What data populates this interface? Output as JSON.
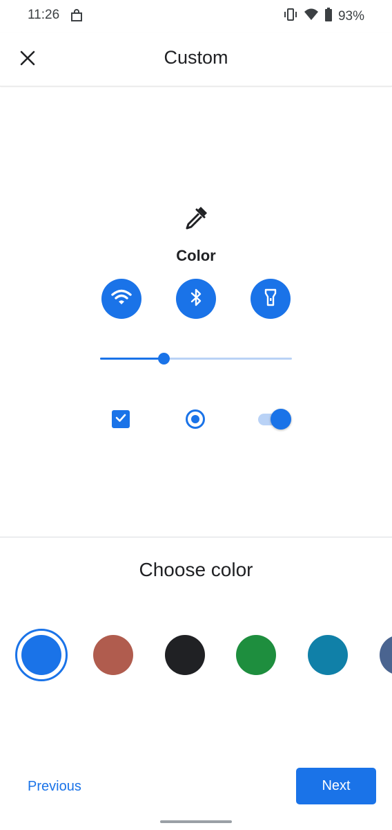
{
  "status_bar": {
    "time": "11:26",
    "battery": "93%",
    "icons": [
      "shopping-bag-icon",
      "vibrate-icon",
      "wifi-signal-icon",
      "battery-icon"
    ]
  },
  "app_bar": {
    "title": "Custom",
    "close_icon": "close-icon"
  },
  "preview": {
    "icon": "color-picker-icon",
    "label": "Color",
    "quick_settings": [
      {
        "icon": "wifi-icon"
      },
      {
        "icon": "bluetooth-icon"
      },
      {
        "icon": "flashlight-icon"
      }
    ],
    "slider_value": 0.33,
    "checkbox_checked": true,
    "radio_selected": true,
    "switch_on": true
  },
  "choose_color": {
    "title": "Choose color",
    "swatches": [
      {
        "color": "#1a73e8",
        "selected": true
      },
      {
        "color": "#b05c4e",
        "selected": false
      },
      {
        "color": "#202124",
        "selected": false
      },
      {
        "color": "#1e8e3e",
        "selected": false
      },
      {
        "color": "#1080a8",
        "selected": false
      },
      {
        "color": "#4a6490",
        "selected": false
      }
    ]
  },
  "footer": {
    "previous_label": "Previous",
    "next_label": "Next"
  },
  "colors": {
    "accent": "#1a73e8",
    "accent_light": "#b9d2f6"
  }
}
